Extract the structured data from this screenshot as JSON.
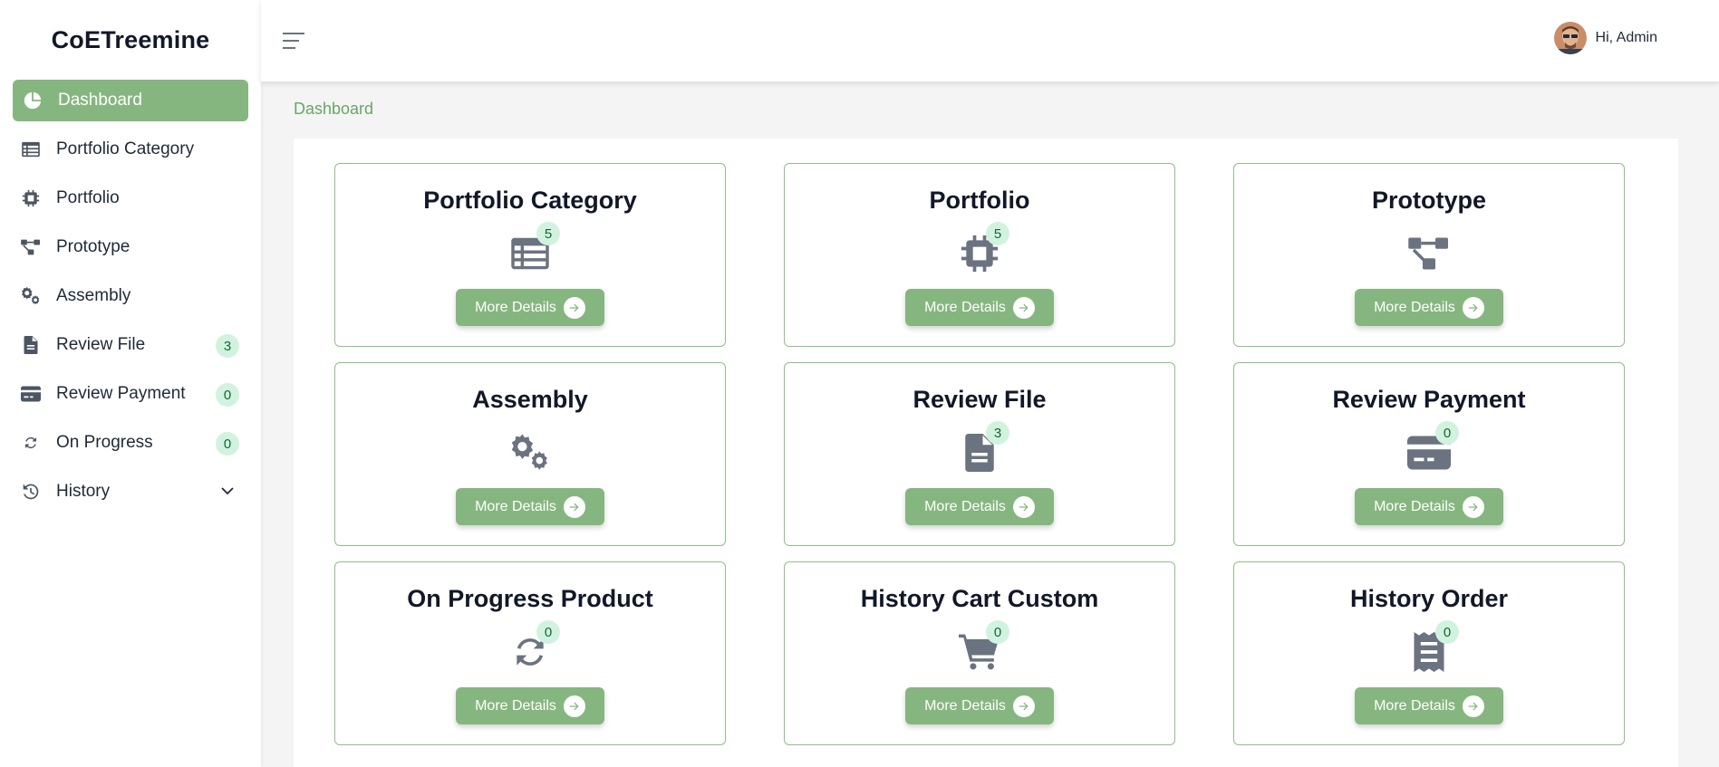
{
  "brand": "CoETreemine",
  "sidebar": {
    "items": [
      {
        "label": "Dashboard",
        "icon": "pie-chart-icon",
        "active": true
      },
      {
        "label": "Portfolio Category",
        "icon": "table-list-icon"
      },
      {
        "label": "Portfolio",
        "icon": "microchip-icon"
      },
      {
        "label": "Prototype",
        "icon": "diagram-project-icon"
      },
      {
        "label": "Assembly",
        "icon": "gears-icon"
      },
      {
        "label": "Review File",
        "icon": "file-icon",
        "badge": "3"
      },
      {
        "label": "Review Payment",
        "icon": "credit-card-icon",
        "badge": "0"
      },
      {
        "label": "On Progress",
        "icon": "refresh-icon",
        "badge": "0"
      },
      {
        "label": "History",
        "icon": "history-icon",
        "expandable": true
      }
    ]
  },
  "topbar": {
    "user_greeting": "Hi, Admin"
  },
  "breadcrumb": "Dashboard",
  "cards": [
    {
      "title": "Portfolio Category",
      "icon": "table-list-icon",
      "badge": "5",
      "button": "More Details"
    },
    {
      "title": "Portfolio",
      "icon": "microchip-icon",
      "badge": "5",
      "button": "More Details"
    },
    {
      "title": "Prototype",
      "icon": "diagram-project-icon",
      "button": "More Details"
    },
    {
      "title": "Assembly",
      "icon": "gears-icon",
      "button": "More Details"
    },
    {
      "title": "Review File",
      "icon": "file-icon",
      "badge": "3",
      "button": "More Details"
    },
    {
      "title": "Review Payment",
      "icon": "credit-card-icon",
      "badge": "0",
      "button": "More Details"
    },
    {
      "title": "On Progress Product",
      "icon": "refresh-icon",
      "badge": "0",
      "button": "More Details"
    },
    {
      "title": "History Cart Custom",
      "icon": "cart-icon",
      "badge": "0",
      "button": "More Details"
    },
    {
      "title": "History Order",
      "icon": "receipt-icon",
      "badge": "0",
      "button": "More Details"
    }
  ],
  "colors": {
    "accent": "#86b67f",
    "badge_bg": "#d1f2df",
    "badge_text": "#166534",
    "icon": "#6b7280",
    "card_border": "#8fbf88"
  }
}
